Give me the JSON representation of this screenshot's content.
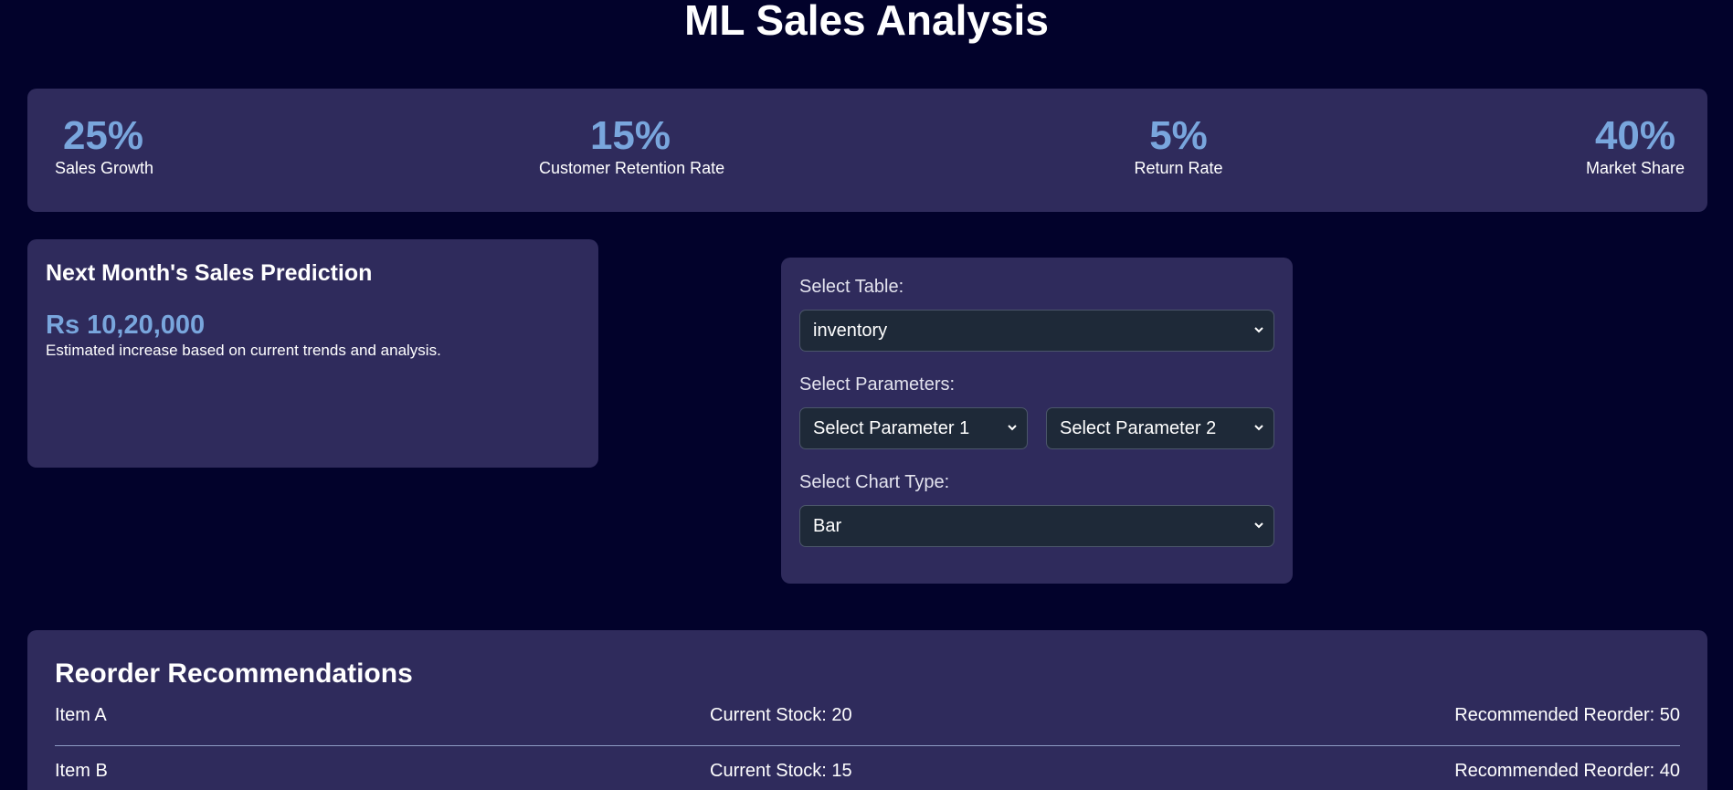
{
  "page": {
    "title": "ML Sales Analysis"
  },
  "stats": [
    {
      "value": "25%",
      "label": "Sales Growth"
    },
    {
      "value": "15%",
      "label": "Customer Retention Rate"
    },
    {
      "value": "5%",
      "label": "Return Rate"
    },
    {
      "value": "40%",
      "label": "Market Share"
    }
  ],
  "prediction": {
    "title": "Next Month's Sales Prediction",
    "value": "Rs 10,20,000",
    "note": "Estimated increase based on current trends and analysis."
  },
  "controls": {
    "table_label": "Select Table:",
    "table_value": "inventory",
    "params_label": "Select Parameters:",
    "param1_value": "Select Parameter 1",
    "param2_value": "Select Parameter 2",
    "chart_label": "Select Chart Type:",
    "chart_value": "Bar"
  },
  "reorder": {
    "title": "Reorder Recommendations",
    "rows": [
      {
        "item": "Item A",
        "stock": "Current Stock: 20",
        "reorder": "Recommended Reorder: 50"
      },
      {
        "item": "Item B",
        "stock": "Current Stock: 15",
        "reorder": "Recommended Reorder: 40"
      }
    ]
  },
  "icons": {
    "dropdown": "chevron-down-icon"
  },
  "colors": {
    "background": "#02022b",
    "card": "#2f2b5c",
    "accent": "#79a6dd",
    "select_bg": "#1e2938"
  }
}
